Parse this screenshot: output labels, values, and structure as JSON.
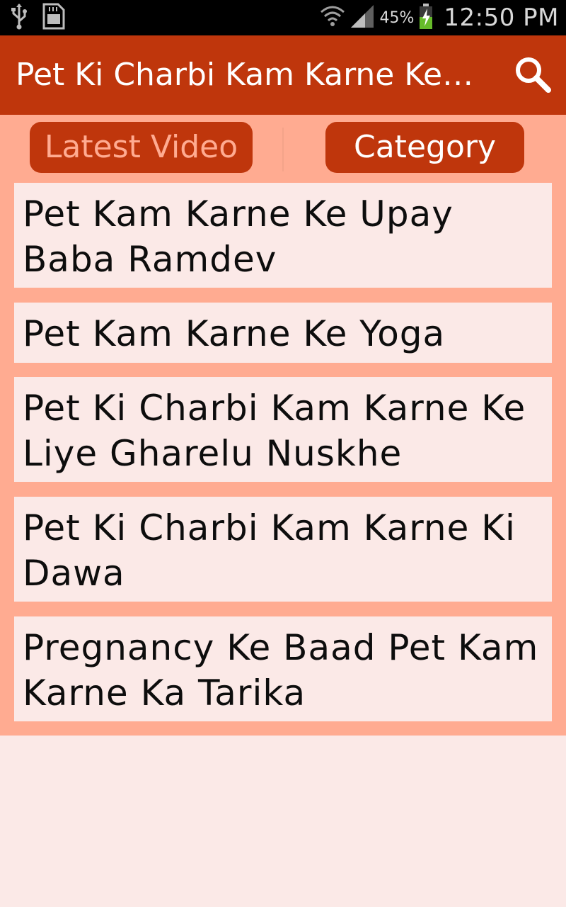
{
  "status_bar": {
    "battery_percent": "45%",
    "time": "12:50 PM",
    "icons": [
      "usb-icon",
      "sd-card-icon",
      "wifi-icon",
      "signal-icon",
      "battery-charging-icon"
    ]
  },
  "app_bar": {
    "title": "Pet Ki Charbi Kam Karne Ke Upay",
    "search_icon": "search-icon"
  },
  "tabs": {
    "latest_label": "Latest Video",
    "category_label": "Category"
  },
  "list": {
    "items": [
      {
        "label": "Pet Kam Karne Ke Upay Baba Ramdev"
      },
      {
        "label": "Pet Kam Karne Ke Yoga"
      },
      {
        "label": "Pet Ki Charbi Kam Karne Ke Liye Gharelu Nuskhe"
      },
      {
        "label": "Pet Ki Charbi Kam Karne Ki Dawa"
      },
      {
        "label": "Pregnancy Ke Baad Pet Kam Karne Ka Tarika"
      }
    ]
  },
  "colors": {
    "app_bar": "#bf360c",
    "content_bg": "#ffab91",
    "item_bg": "#fbe9e7",
    "tab_inactive_text": "#ffab91",
    "tab_active_text": "#ffffff"
  }
}
